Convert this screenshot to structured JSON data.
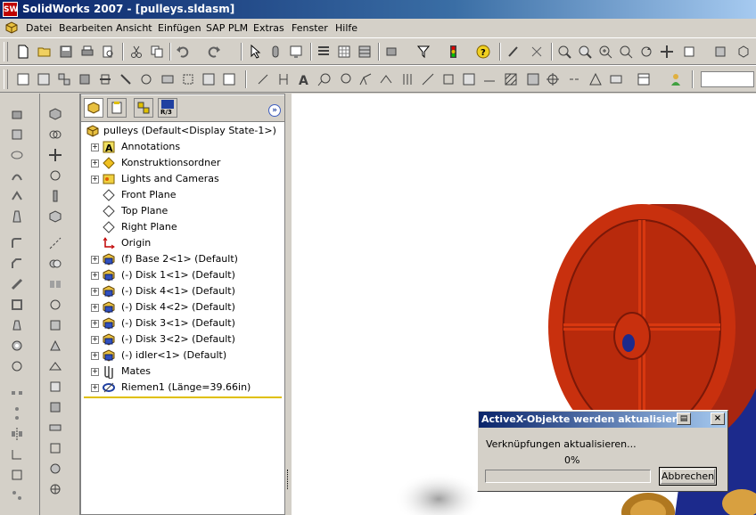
{
  "window": {
    "title": "SolidWorks 2007 - [pulleys.sldasm]",
    "logo_text": "SW"
  },
  "menu": {
    "items": [
      "Datei",
      "Bearbeiten",
      "Ansicht",
      "Einfügen",
      "SAP PLM",
      "Extras",
      "Fenster",
      "Hilfe"
    ]
  },
  "tree": {
    "root_label": "pulleys  (Default<Display State-1>)",
    "items": [
      {
        "label": "Annotations",
        "icon": "annotation-icon",
        "expandable": true
      },
      {
        "label": "Konstruktionsordner",
        "icon": "design-folder-icon",
        "expandable": true
      },
      {
        "label": "Lights and Cameras",
        "icon": "lights-icon",
        "expandable": true
      },
      {
        "label": "Front Plane",
        "icon": "plane-icon",
        "expandable": false
      },
      {
        "label": "Top Plane",
        "icon": "plane-icon",
        "expandable": false
      },
      {
        "label": "Right Plane",
        "icon": "plane-icon",
        "expandable": false
      },
      {
        "label": "Origin",
        "icon": "origin-icon",
        "expandable": false
      },
      {
        "label": "(f) Base 2<1> (Default)",
        "icon": "part-icon",
        "expandable": true
      },
      {
        "label": "(-) Disk 1<1> (Default)",
        "icon": "part-icon",
        "expandable": true
      },
      {
        "label": "(-) Disk 4<1> (Default)",
        "icon": "part-icon",
        "expandable": true
      },
      {
        "label": "(-) Disk 4<2> (Default)",
        "icon": "part-icon",
        "expandable": true
      },
      {
        "label": "(-) Disk 3<1> (Default)",
        "icon": "part-icon",
        "expandable": true
      },
      {
        "label": "(-) Disk 3<2> (Default)",
        "icon": "part-icon",
        "expandable": true
      },
      {
        "label": "(-) idler<1> (Default)",
        "icon": "part-icon",
        "expandable": true
      },
      {
        "label": "Mates",
        "icon": "mates-icon",
        "expandable": true
      },
      {
        "label": "Riemen1 (Länge=39.66in)",
        "icon": "belt-icon",
        "expandable": true
      }
    ]
  },
  "fm_tabs": [
    {
      "name": "feature-manager-tab",
      "label": ""
    },
    {
      "name": "property-manager-tab",
      "label": ""
    },
    {
      "name": "configuration-manager-tab",
      "label": ""
    },
    {
      "name": "r3-tab",
      "label": "R/3"
    }
  ],
  "dialog": {
    "title": "ActiveX-Objekte werden aktualisiert",
    "message": "Verknüpfungen aktualisieren...",
    "percent_text": "0%",
    "progress": 0,
    "cancel_label": "Abbrechen"
  },
  "colors": {
    "pulley_red": "#c8300e",
    "pulley_dark": "#7a1808",
    "belt_blue": "#1c2a8c",
    "hub_tan": "#d8a040"
  }
}
